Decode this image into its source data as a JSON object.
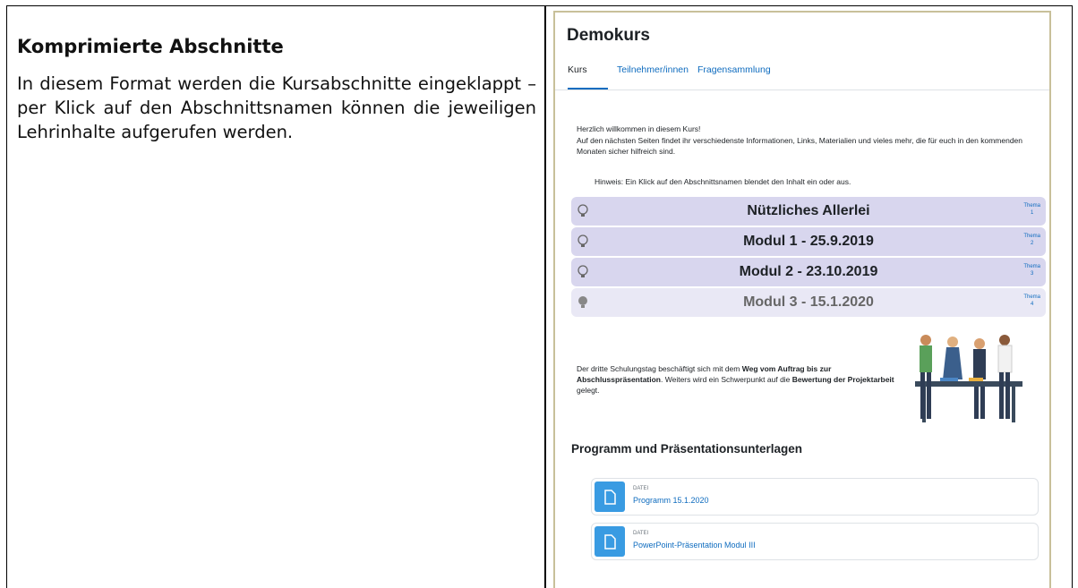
{
  "document": {
    "heading": "Komprimierte Abschnitte",
    "body": "In diesem Format werden die Kursabschnitte eingeklappt – per Klick auf den Abschnittsnamen können die jeweiligen Lehrinhalte aufgerufen werden."
  },
  "course": {
    "title": "Demokurs",
    "tabs": [
      {
        "label": "Kurs",
        "active": true
      },
      {
        "label": "Teilnehmer/innen",
        "active": false
      },
      {
        "label": "Fragensammlung",
        "active": false
      }
    ],
    "welcome": "Herzlich willkommen in diesem Kurs!",
    "intro": "Auf den nächsten Seiten findet ihr verschiedenste Informationen, Links, Materialien und vieles mehr, die für euch in den kommenden Monaten sicher hilfreich sind.",
    "hint": "Hinweis: Ein Klick auf den Abschnittsnamen blendet den Inhalt ein oder aus.",
    "sections": [
      {
        "title": "Nützliches Allerlei",
        "thema": "Thema",
        "number": "1",
        "expanded": false
      },
      {
        "title": "Modul 1 - 25.9.2019",
        "thema": "Thema",
        "number": "2",
        "expanded": false
      },
      {
        "title": "Modul 2 - 23.10.2019",
        "thema": "Thema",
        "number": "3",
        "expanded": false
      },
      {
        "title": "Modul 3 - 15.1.2020",
        "thema": "Thema",
        "number": "4",
        "expanded": true
      }
    ],
    "description": {
      "p1": "Der dritte Schulungstag beschäftigt sich mit dem ",
      "b1": "Weg vom Auftrag bis zur Abschlusspräsentation",
      "p2": ". Weiters wird ein Schwerpunkt auf die ",
      "b2": "Bewertung der Projektarbeit",
      "p3": " gelegt."
    },
    "program_heading": "Programm und Präsentationsunterlagen",
    "files": [
      {
        "type": "DATEI",
        "name": "Programm 15.1.2020"
      },
      {
        "type": "DATEI",
        "name": "PowerPoint-Präsentation Modul III"
      }
    ]
  },
  "colors": {
    "accent": "#0f6cbf",
    "section_bg": "#d8d6ee",
    "file_icon": "#399be2"
  }
}
